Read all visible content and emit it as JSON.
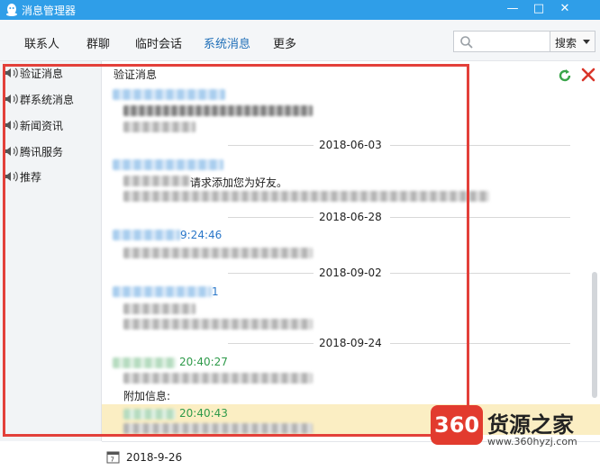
{
  "window": {
    "title": "消息管理器",
    "controls": {
      "minimize": "—",
      "maximize": "□",
      "close": "✕"
    }
  },
  "tabs": [
    {
      "label": "联系人",
      "active": false
    },
    {
      "label": "群聊",
      "active": false
    },
    {
      "label": "临时会话",
      "active": false
    },
    {
      "label": "系统消息",
      "active": true
    },
    {
      "label": "更多",
      "active": false
    }
  ],
  "search": {
    "placeholder": "",
    "button_label": "搜索"
  },
  "sidebar": {
    "items": [
      {
        "label": "验证消息"
      },
      {
        "label": "群系统消息"
      },
      {
        "label": "新闻资讯"
      },
      {
        "label": "腾讯服务"
      },
      {
        "label": "推荐"
      }
    ]
  },
  "main": {
    "section_title": "验证消息",
    "dates": [
      "2018-06-03",
      "2018-06-28",
      "2018-09-02",
      "2018-09-24"
    ],
    "messages": [
      {
        "text": ""
      },
      {
        "text": "请求添加您为好友。"
      },
      {
        "time": "9:24:46"
      },
      {
        "time": "1"
      },
      {
        "time": "20:40:27",
        "extra_label": "附加信息:"
      },
      {
        "time": "20:40:43"
      }
    ]
  },
  "bottom": {
    "date": "2018-9-26"
  },
  "watermark": {
    "badge": "360",
    "name": "货源之家",
    "url": "www.360hyzj.com"
  },
  "colors": {
    "titlebar": "#2f9ee8",
    "active_tab": "#1f6fb8",
    "highlight_frame": "#e3403a",
    "selected_row": "#fbeec3"
  }
}
